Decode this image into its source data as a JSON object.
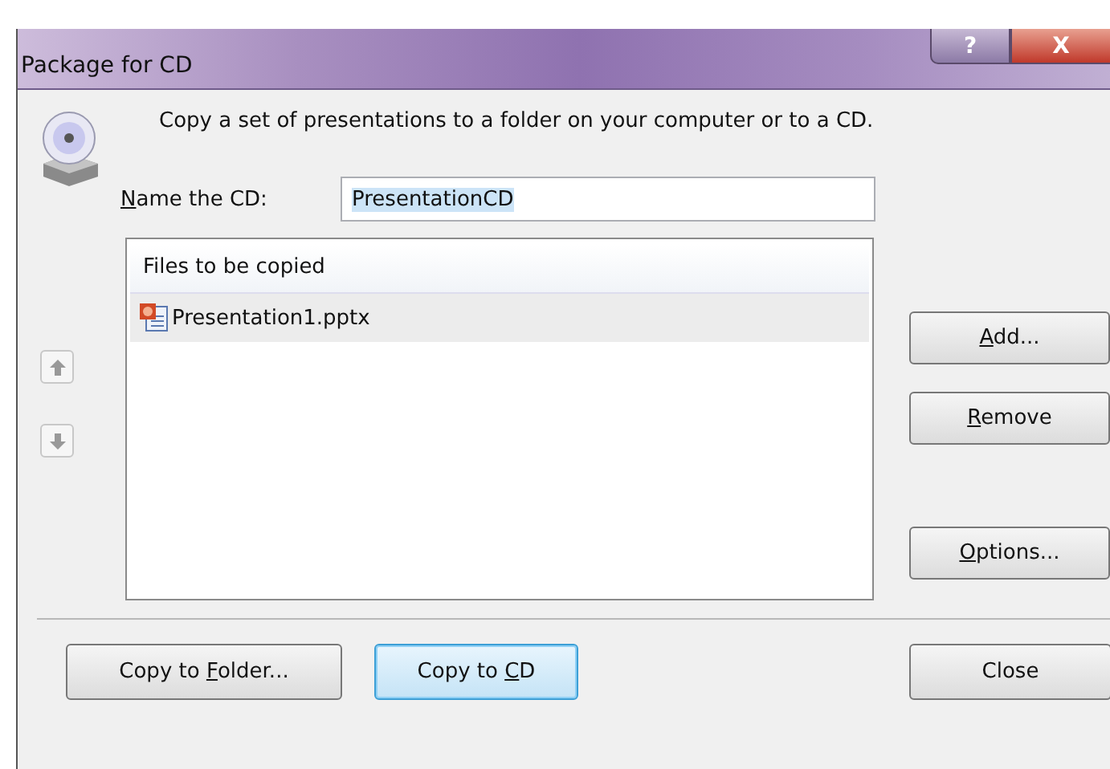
{
  "window": {
    "title": "Package for CD",
    "caption_buttons": [
      {
        "kind": "help",
        "label": "?"
      },
      {
        "kind": "close",
        "label": "X"
      }
    ]
  },
  "description": "Copy a set of presentations to a folder on your computer or to a CD.",
  "name_field": {
    "label": {
      "key": "N",
      "after": "ame the CD:"
    },
    "value": "PresentationCD",
    "text_selected": true
  },
  "file_list": {
    "header": "Files to be copied",
    "rows": [
      {
        "name": "Presentation1.pptx",
        "selected": true
      }
    ]
  },
  "order_buttons": [
    {
      "kind": "up"
    },
    {
      "kind": "down"
    }
  ],
  "side_buttons": [
    {
      "key": "A",
      "after": "dd..."
    },
    {
      "key": "R",
      "after": "emove"
    },
    {
      "key": "O",
      "after": "ptions..."
    }
  ],
  "bottom_buttons": [
    {
      "before": "Copy to ",
      "key": "F",
      "after": "older...",
      "default": false
    },
    {
      "before": "Copy to ",
      "key": "C",
      "after": "D",
      "default": true
    },
    {
      "after": "Close",
      "default": false
    }
  ]
}
